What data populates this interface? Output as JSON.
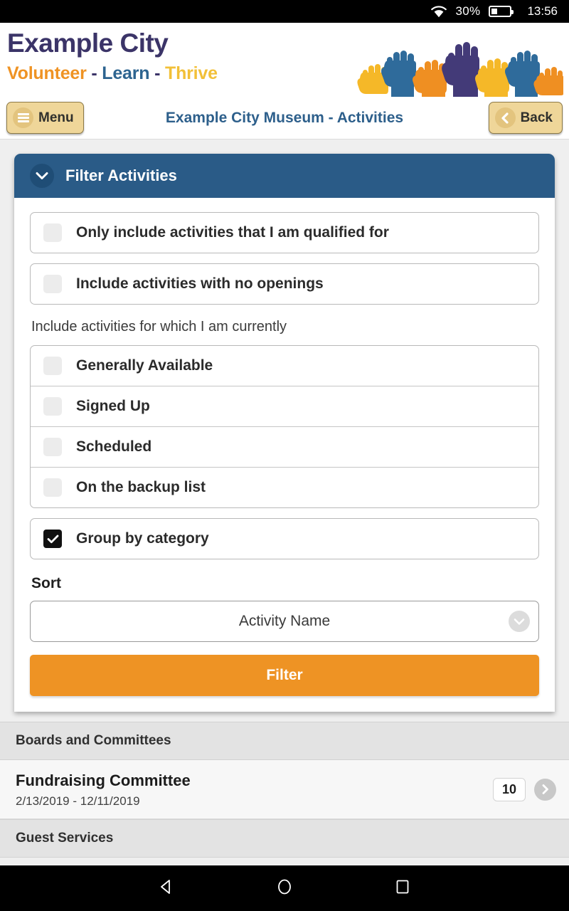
{
  "statusbar": {
    "wifi_icon": "wifi-icon",
    "battery_pct": "30%",
    "battery_icon": "battery-icon",
    "time": "13:56"
  },
  "brand": {
    "title": "Example City",
    "tagline": {
      "volunteer": "Volunteer",
      "dash1": "-",
      "learn": "Learn",
      "dash2": "-",
      "thrive": "Thrive"
    },
    "logo_icon": "raised-hands-logo"
  },
  "nav": {
    "menu_label": "Menu",
    "menu_icon": "hamburger-icon",
    "back_label": "Back",
    "back_icon": "chevron-left-icon",
    "page_title": "Example City Museum - Activities"
  },
  "filter_panel": {
    "header_title": "Filter Activities",
    "header_icon": "chevron-down-icon",
    "top_checkboxes": [
      {
        "label": "Only include activities that I am qualified for",
        "checked": false
      },
      {
        "label": "Include activities with no openings",
        "checked": false
      }
    ],
    "subheading": "Include activities for which I am currently",
    "status_checkboxes": [
      {
        "label": "Generally Available",
        "checked": false
      },
      {
        "label": "Signed Up",
        "checked": false
      },
      {
        "label": "Scheduled",
        "checked": false
      },
      {
        "label": "On the backup list",
        "checked": false
      }
    ],
    "group_checkbox": {
      "label": "Group by category",
      "checked": true
    },
    "sort_label": "Sort",
    "sort_value": "Activity Name",
    "sort_icon": "chevron-down-icon",
    "filter_button": "Filter"
  },
  "results": [
    {
      "group": "Boards and Committees",
      "rows": [
        {
          "title": "Fundraising Committee",
          "dates": "2/13/2019 - 12/11/2019",
          "badge": "10",
          "chevron_icon": "chevron-right-icon"
        }
      ]
    },
    {
      "group": "Guest Services",
      "rows": []
    }
  ],
  "android_nav": {
    "back_icon": "triangle-back-icon",
    "home_icon": "circle-home-icon",
    "recents_icon": "square-recents-icon"
  },
  "colors": {
    "brand_purple": "#3b3468",
    "brand_orange": "#ef9324",
    "brand_blue": "#2d6490",
    "brand_yellow": "#f2c038",
    "panel_blue": "#2a5b87",
    "title_blue": "#2d5f8b",
    "button_orange": "#ee9324",
    "button_tan": "#efd699"
  }
}
